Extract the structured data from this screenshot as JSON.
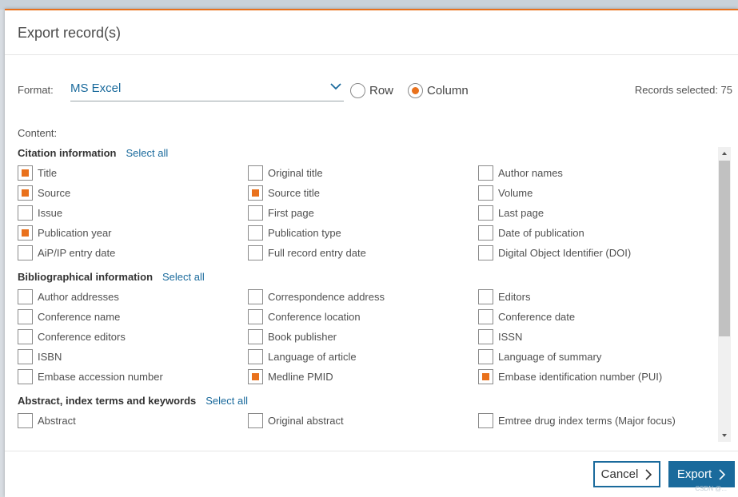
{
  "dialog": {
    "title": "Export record(s)"
  },
  "format": {
    "label": "Format:",
    "selected": "MS Excel",
    "orientation_options": [
      {
        "label": "Row",
        "checked": false
      },
      {
        "label": "Column",
        "checked": true
      }
    ],
    "records_selected": "Records selected: 75"
  },
  "content_label": "Content:",
  "sections": [
    {
      "title": "Citation information",
      "select_all": "Select all",
      "items": [
        {
          "label": "Title",
          "checked": true
        },
        {
          "label": "Original title",
          "checked": false
        },
        {
          "label": "Author names",
          "checked": false
        },
        {
          "label": "Source",
          "checked": true
        },
        {
          "label": "Source title",
          "checked": true
        },
        {
          "label": "Volume",
          "checked": false
        },
        {
          "label": "Issue",
          "checked": false
        },
        {
          "label": "First page",
          "checked": false
        },
        {
          "label": "Last page",
          "checked": false
        },
        {
          "label": "Publication year",
          "checked": true
        },
        {
          "label": "Publication type",
          "checked": false
        },
        {
          "label": "Date of publication",
          "checked": false
        },
        {
          "label": "AiP/IP entry date",
          "checked": false
        },
        {
          "label": "Full record entry date",
          "checked": false
        },
        {
          "label": "Digital Object Identifier (DOI)",
          "checked": false
        }
      ]
    },
    {
      "title": "Bibliographical information",
      "select_all": "Select all",
      "items": [
        {
          "label": "Author addresses",
          "checked": false
        },
        {
          "label": "Correspondence address",
          "checked": false
        },
        {
          "label": "Editors",
          "checked": false
        },
        {
          "label": "Conference name",
          "checked": false
        },
        {
          "label": "Conference location",
          "checked": false
        },
        {
          "label": "Conference date",
          "checked": false
        },
        {
          "label": "Conference editors",
          "checked": false
        },
        {
          "label": "Book publisher",
          "checked": false
        },
        {
          "label": "ISSN",
          "checked": false
        },
        {
          "label": "ISBN",
          "checked": false
        },
        {
          "label": "Language of article",
          "checked": false
        },
        {
          "label": "Language of summary",
          "checked": false
        },
        {
          "label": "Embase accession number",
          "checked": false
        },
        {
          "label": "Medline PMID",
          "checked": true
        },
        {
          "label": "Embase identification number (PUI)",
          "checked": true
        }
      ]
    },
    {
      "title": "Abstract, index terms and keywords",
      "select_all": "Select all",
      "items": [
        {
          "label": "Abstract",
          "checked": false
        },
        {
          "label": "Original abstract",
          "checked": false
        },
        {
          "label": "Emtree drug index terms (Major focus)",
          "checked": false
        }
      ]
    }
  ],
  "footer": {
    "cancel_label": "Cancel",
    "export_label": "Export"
  },
  "watermark": "CSDN @...",
  "icons": {
    "dropdown": "chevron-down-icon",
    "button_arrow": "chevron-right-icon",
    "scroll_up": "triangle-up-icon",
    "scroll_down": "triangle-down-icon"
  },
  "colors": {
    "accent": "#e9711c",
    "primary": "#1a6a9c"
  }
}
